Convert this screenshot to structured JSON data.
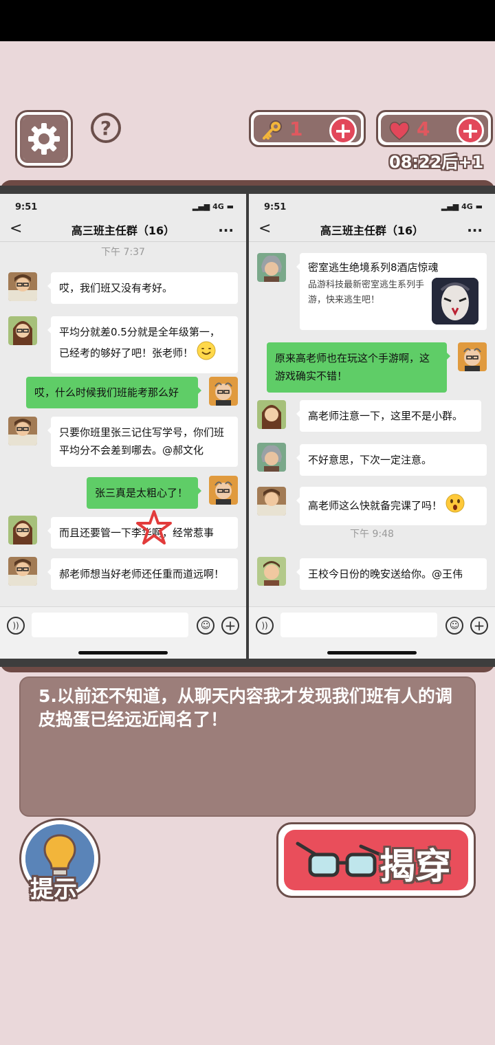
{
  "hud": {
    "keys": "1",
    "lives": "4",
    "timer": "08:22后+1",
    "help": "?",
    "plus": "+"
  },
  "left_chat": {
    "status_time": "9:51",
    "network": "4G",
    "title": "高三班主任群（16）",
    "more": "...",
    "back": "<",
    "timestamp": "下午 7:37",
    "messages": [
      {
        "side": "left",
        "text": "哎，我们班又没有考好。"
      },
      {
        "side": "left",
        "text": "平均分就差0.5分就是全年级第一，已经考的够好了吧！张老师！"
      },
      {
        "side": "right",
        "text": "哎，什么时候我们班能考那么好"
      },
      {
        "side": "left",
        "text": "只要你班里张三记住写学号，你们班平均分不会差到哪去。@郝文化"
      },
      {
        "side": "right",
        "text": "张三真是太粗心了！"
      },
      {
        "side": "left",
        "text": "而且还要管一下李华啊，经常惹事"
      },
      {
        "side": "left",
        "text": "郝老师想当好老师还任重而道远啊！"
      }
    ]
  },
  "right_chat": {
    "status_time": "9:51",
    "network": "4G",
    "title": "高三班主任群（16）",
    "more": "...",
    "back": "<",
    "timestamp": "下午 9:48",
    "promo": {
      "title": "密室逃生绝境系列8酒店惊魂",
      "desc": "品游科技最新密室逃生系列手游，快来逃生吧！"
    },
    "messages": [
      {
        "side": "right",
        "text": "原来高老师也在玩这个手游啊，这游戏确实不错！"
      },
      {
        "side": "left",
        "text": "高老师注意一下，这里不是小群。"
      },
      {
        "side": "left",
        "text": "不好意思，下次一定注意。"
      },
      {
        "side": "left",
        "text": "高老师这么快就备完课了吗！"
      },
      {
        "side": "left",
        "text": "王校今日份的晚安送给你。@王伟"
      }
    ]
  },
  "question": "5.以前还不知道，从聊天内容我才发现我们班有人的调皮捣蛋已经远近闻名了！",
  "buttons": {
    "hint": "提示",
    "reveal": "揭穿"
  },
  "colors": {
    "accent_red": "#e94e5b",
    "frame_brown": "#6e4a45",
    "wechat_green": "#5fcd67"
  }
}
